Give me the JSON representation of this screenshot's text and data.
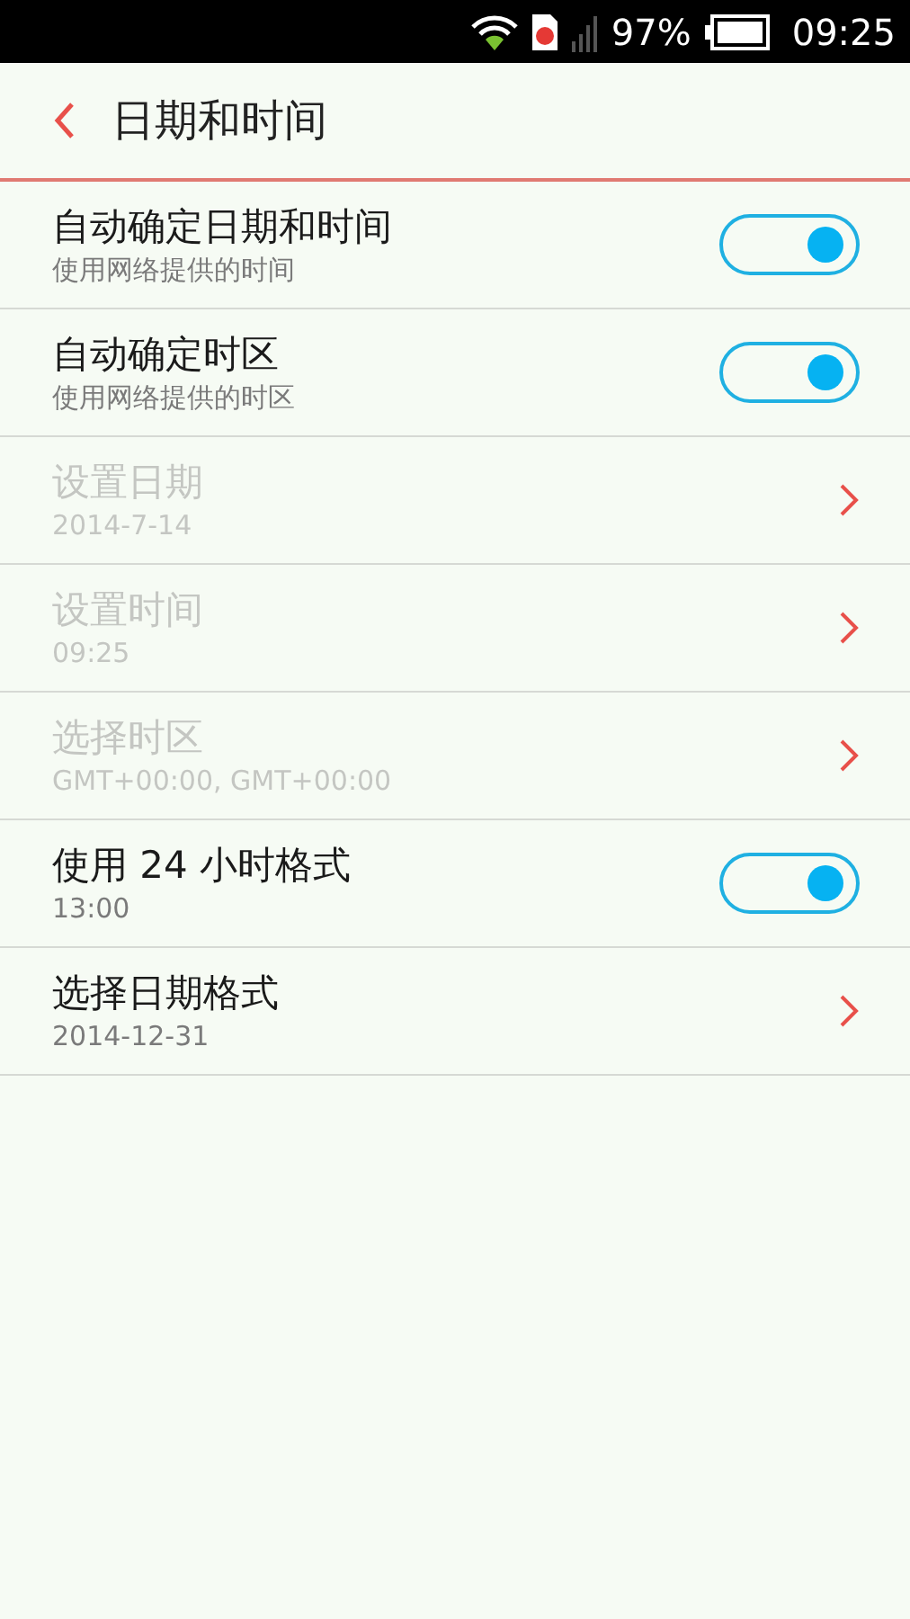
{
  "status_bar": {
    "battery": "97%",
    "time": "09:25"
  },
  "header": {
    "title": "日期和时间"
  },
  "items": [
    {
      "kind": "toggle",
      "title": "自动确定日期和时间",
      "subtitle": "使用网络提供的时间",
      "on": true,
      "disabled": false
    },
    {
      "kind": "toggle",
      "title": "自动确定时区",
      "subtitle": "使用网络提供的时区",
      "on": true,
      "disabled": false
    },
    {
      "kind": "link",
      "title": "设置日期",
      "subtitle": "2014-7-14",
      "disabled": true
    },
    {
      "kind": "link",
      "title": "设置时间",
      "subtitle": "09:25",
      "disabled": true
    },
    {
      "kind": "link",
      "title": "选择时区",
      "subtitle": "GMT+00:00, GMT+00:00",
      "disabled": true
    },
    {
      "kind": "toggle",
      "title": "使用 24 小时格式",
      "subtitle": "13:00",
      "on": true,
      "disabled": false
    },
    {
      "kind": "link",
      "title": "选择日期格式",
      "subtitle": "2014-12-31",
      "disabled": false
    }
  ]
}
